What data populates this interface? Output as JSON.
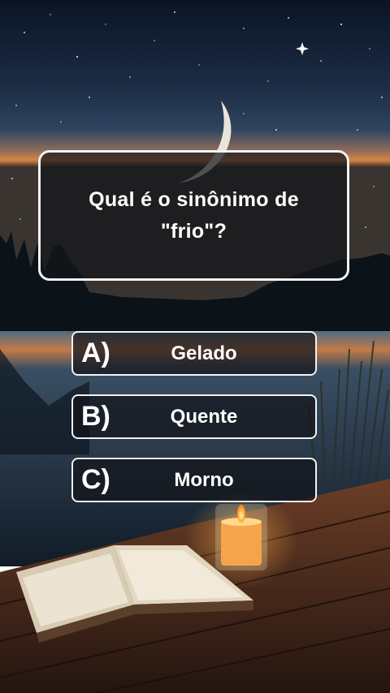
{
  "question": {
    "text": "Qual é o sinônimo de \"frio\"?"
  },
  "options": [
    {
      "letter": "A)",
      "text": "Gelado"
    },
    {
      "letter": "B)",
      "text": "Quente"
    },
    {
      "letter": "C)",
      "text": "Morno"
    }
  ],
  "colors": {
    "card_border": "#f2f2f2",
    "card_fill": "#14161c",
    "text": "#ffffff",
    "sky_top": "#0b1424",
    "horizon_glow": "#d98442",
    "candle_flame": "#ffc457"
  }
}
